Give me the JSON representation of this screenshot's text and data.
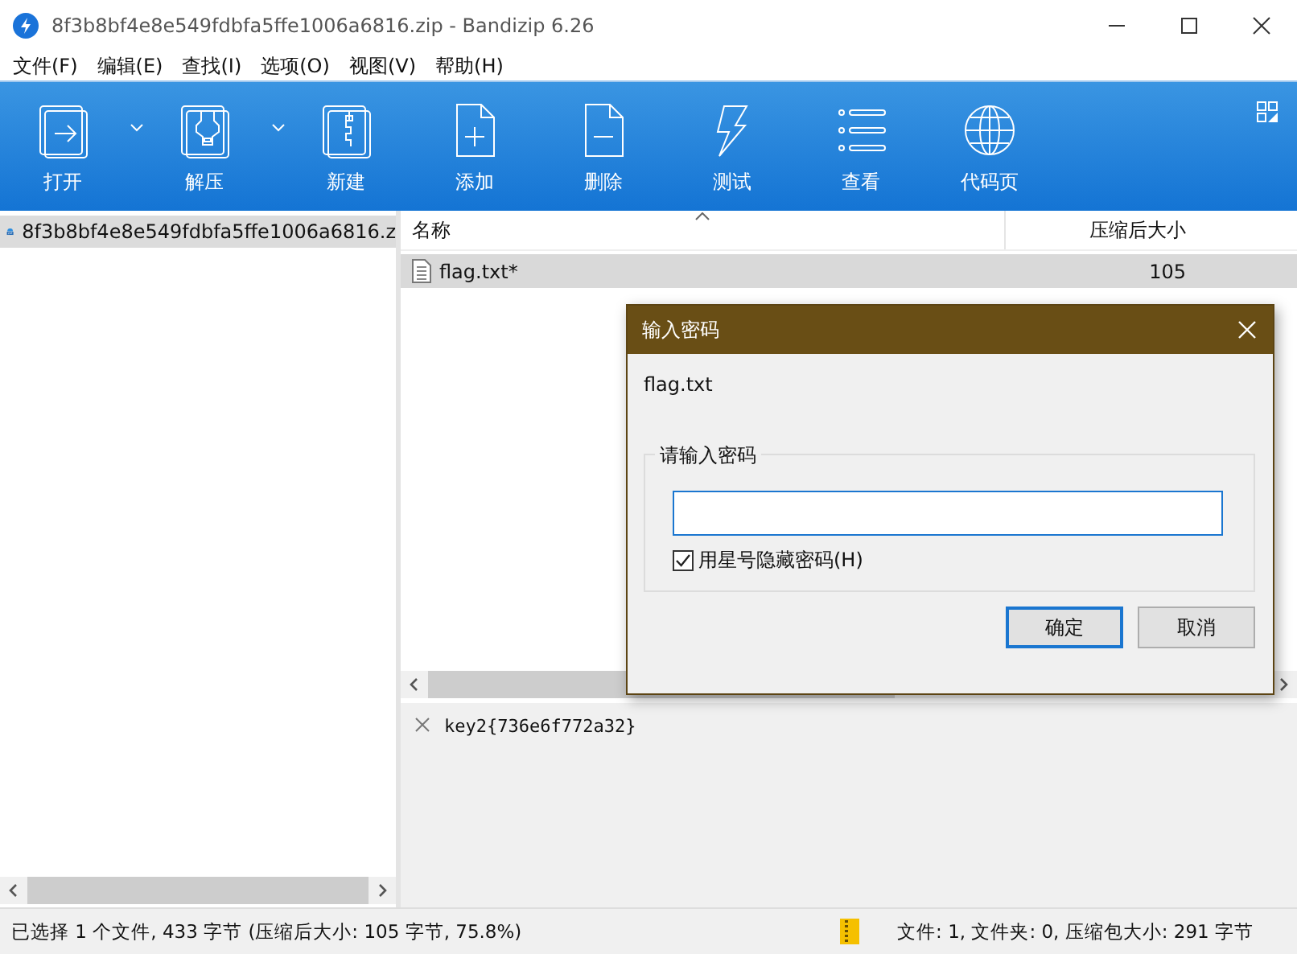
{
  "window": {
    "title": "8f3b8bf4e8e549fdbfa5ffe1006a6816.zip - Bandizip 6.26"
  },
  "menu": [
    "文件(F)",
    "编辑(E)",
    "查找(I)",
    "选项(O)",
    "视图(V)",
    "帮助(H)"
  ],
  "toolbar": [
    {
      "label": "打开",
      "dropdown": true
    },
    {
      "label": "解压",
      "dropdown": true
    },
    {
      "label": "新建",
      "dropdown": false
    },
    {
      "label": "添加",
      "dropdown": false
    },
    {
      "label": "删除",
      "dropdown": false
    },
    {
      "label": "测试",
      "dropdown": false
    },
    {
      "label": "查看",
      "dropdown": false
    },
    {
      "label": "代码页",
      "dropdown": false
    }
  ],
  "tree": {
    "items": [
      {
        "label": "8f3b8bf4e8e549fdbfa5ffe1006a6816.z",
        "selected": true
      }
    ]
  },
  "table": {
    "columns": [
      "名称",
      "压缩后大小"
    ],
    "rows": [
      {
        "name": "flag.txt*",
        "size": "105",
        "selected": true
      }
    ]
  },
  "comment": {
    "text": "key2{736e6f772a32}"
  },
  "dialog": {
    "title": "输入密码",
    "file": "flag.txt",
    "group_label": "请输入密码",
    "checkbox": {
      "label": "用星号隐藏密码(H)",
      "checked": true
    },
    "buttons": [
      "确定",
      "取消"
    ]
  },
  "status_bar": {
    "left": "已选择 1 个文件, 433 字节 (压缩后大小: 105 字节, 75.8%)",
    "right": "文件: 1, 文件夹: 0, 压缩包大小: 291 字节"
  }
}
